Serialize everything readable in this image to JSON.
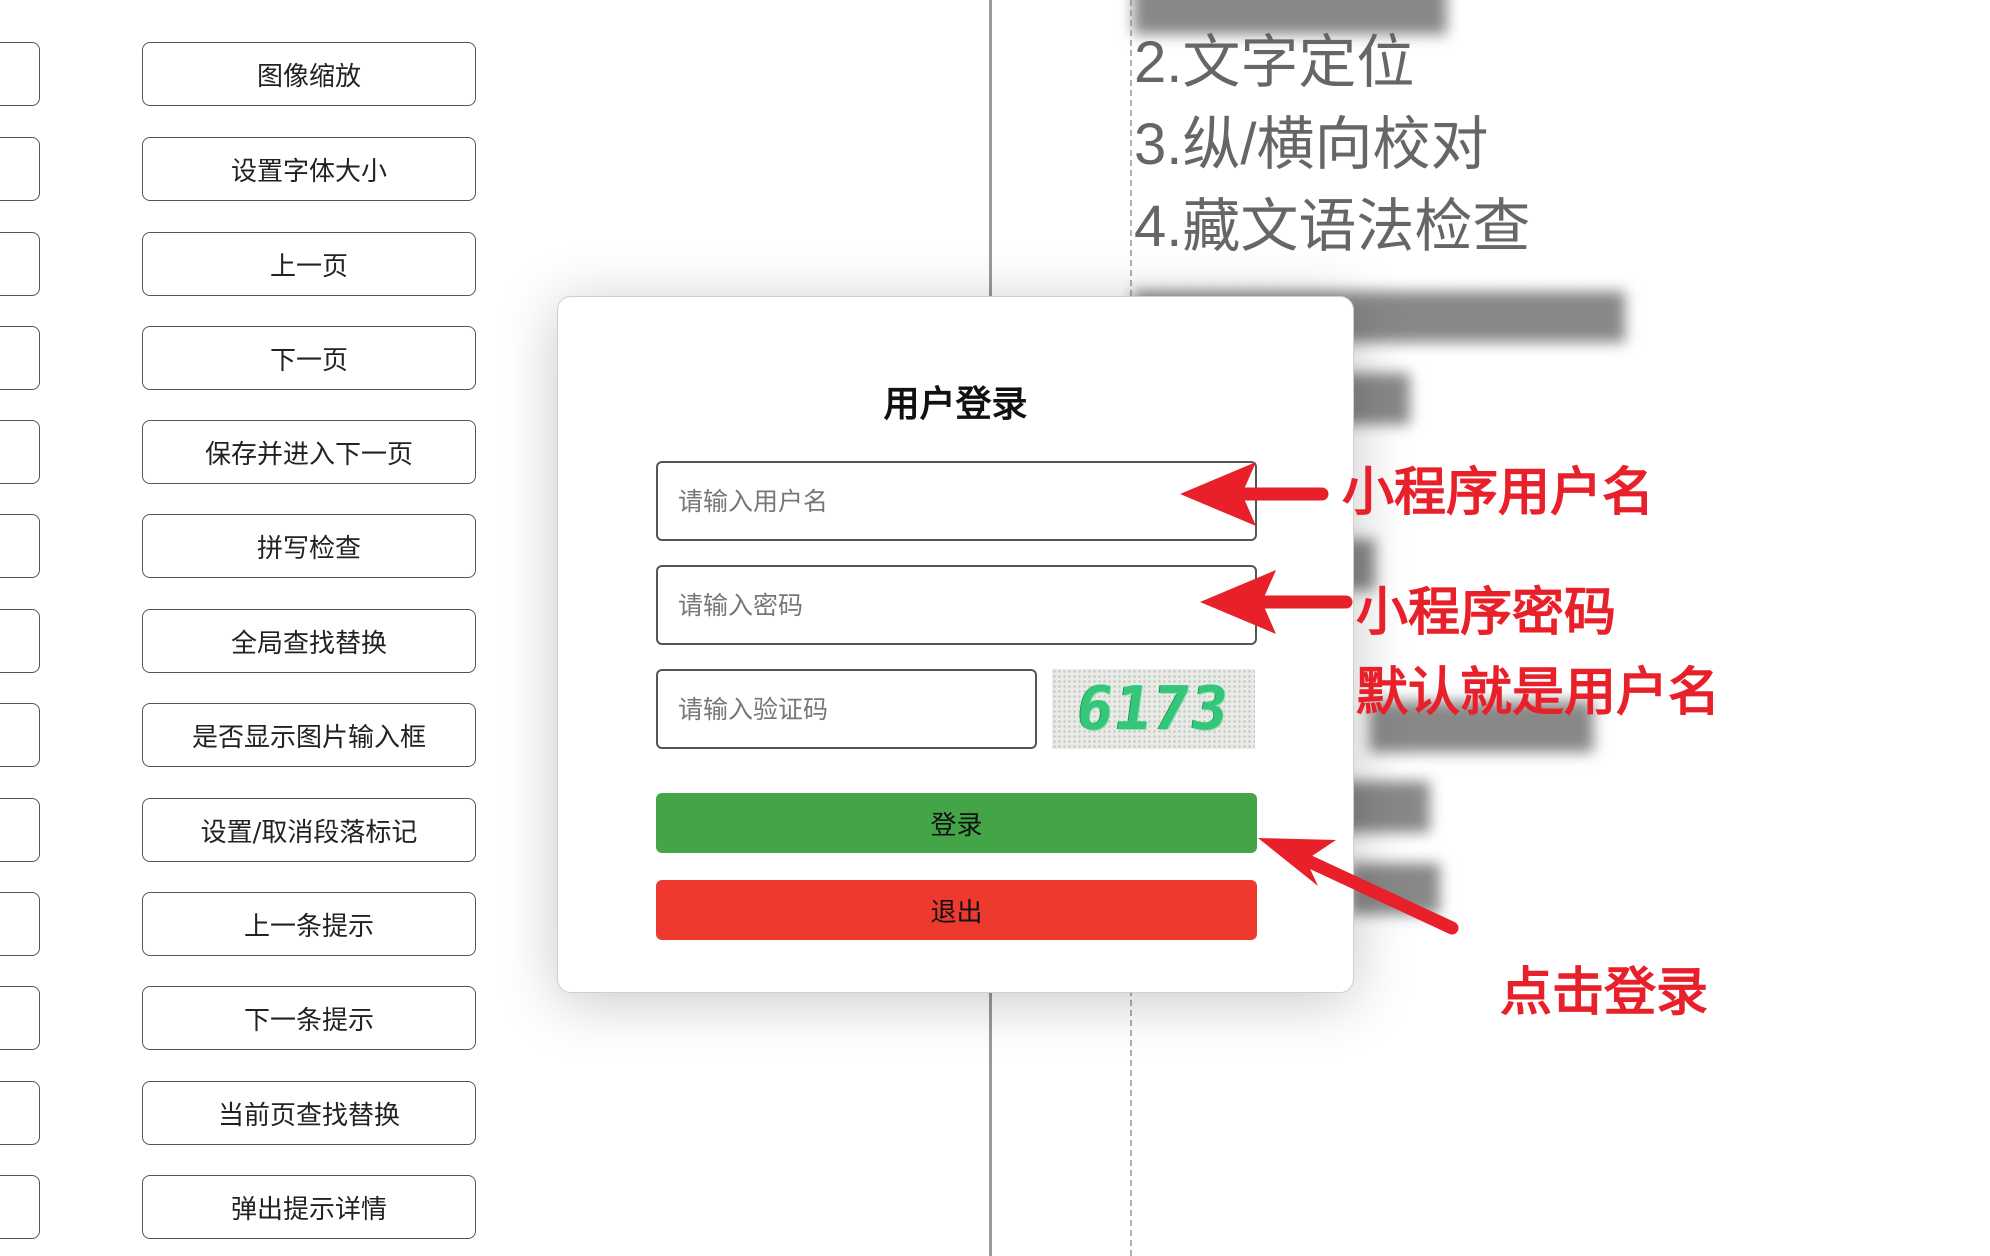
{
  "left_panel": {
    "buttons": [
      "图像缩放",
      "设置字体大小",
      "上一页",
      "下一页",
      "保存并进入下一页",
      "拼写检查",
      "全局查找替换",
      "是否显示图片输入框",
      "设置/取消段落标记",
      "上一条提示",
      "下一条提示",
      "当前页查找替换",
      "弹出提示详情"
    ]
  },
  "feature_list": {
    "items": [
      "2.文字定位",
      "3.纵/横向校对",
      "4.藏文语法检查"
    ]
  },
  "login_modal": {
    "title": "用户登录",
    "username_placeholder": "请输入用户名",
    "password_placeholder": "请输入密码",
    "captcha_placeholder": "请输入验证码",
    "captcha_text": "6173",
    "login_label": "登录",
    "exit_label": "退出"
  },
  "annotations": {
    "username_note": "小程序用户名",
    "password_note": "小程序密码",
    "password_default_note": "默认就是用户名",
    "login_note": "点击登录",
    "color": "#e8202a"
  },
  "colors": {
    "login_button": "#43a548",
    "exit_button": "#ee3a2e",
    "captcha_text": "#34c77a"
  }
}
